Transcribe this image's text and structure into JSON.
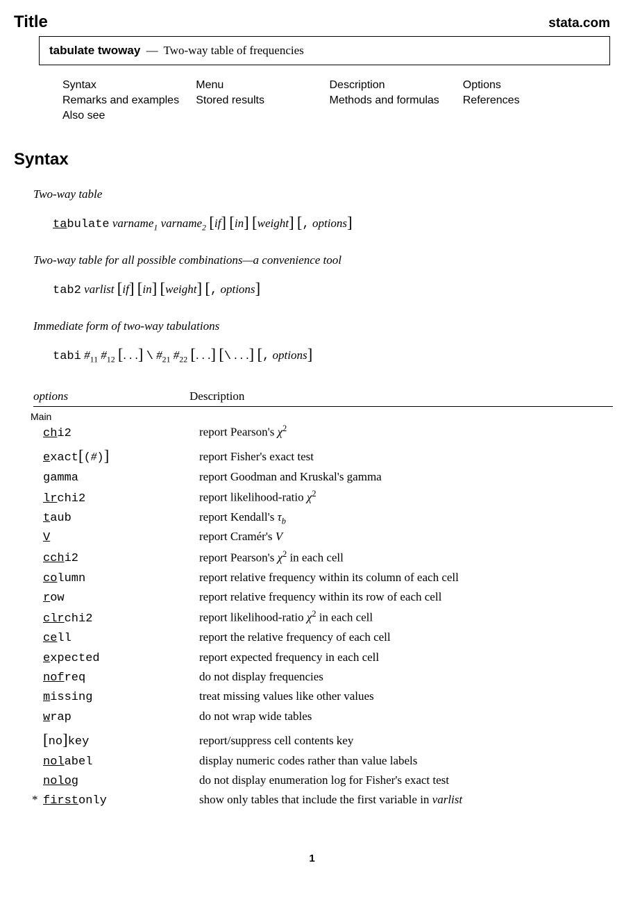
{
  "header": {
    "title": "Title",
    "site": "stata.com"
  },
  "titlebox": {
    "cmd": "tabulate twoway",
    "dash": "—",
    "desc": "Two-way table of frequencies"
  },
  "nav": {
    "r1c1": "Syntax",
    "r1c2": "Menu",
    "r1c3": "Description",
    "r1c4": "Options",
    "r2c1": "Remarks and examples",
    "r2c2": "Stored results",
    "r2c3": "Methods and formulas",
    "r2c4": "References",
    "r3c1": "Also see"
  },
  "section_syntax": "Syntax",
  "sub1": "Two-way table",
  "syn1": {
    "cmd_u": "ta",
    "cmd_r": "bulate",
    "v1": "varname",
    "v2": "varname",
    "if": "if",
    "in": "in",
    "wt": "weight",
    "comma": ",",
    "opts": "options"
  },
  "sub2": "Two-way table for all possible combinations—a convenience tool",
  "syn2": {
    "cmd": "tab2",
    "vl": "varlist",
    "if": "if",
    "in": "in",
    "wt": "weight",
    "comma": ",",
    "opts": "options"
  },
  "sub3": "Immediate form of two-way tabulations",
  "syn3": {
    "cmd": "tabi",
    "hash": "#",
    "dots": ". . .",
    "bs": "\\",
    "comma": ",",
    "opts": "options"
  },
  "opthead": {
    "c1": "options",
    "c2": "Description"
  },
  "group_main": "Main",
  "opts": {
    "chi2": {
      "u": "ch",
      "r": "i2",
      "desc_a": "report Pearson's ",
      "desc_b": ""
    },
    "exact": {
      "u": "e",
      "r": "xact",
      "arg_l": "(",
      "arg_h": "#",
      "arg_r": ")",
      "desc": "report Fisher's exact test"
    },
    "gamma": {
      "u": "g",
      "r": "amma",
      "desc": "report Goodman and Kruskal's gamma"
    },
    "lrchi2": {
      "u": "lr",
      "r": "chi2",
      "desc_a": "report likelihood-ratio "
    },
    "taub": {
      "u": "t",
      "r": "aub",
      "desc_a": "report Kendall's "
    },
    "V": {
      "u": "V",
      "r": "",
      "desc_a": "report Cramér's ",
      "sym": "V"
    },
    "cchi2": {
      "u": "cch",
      "r": "i2",
      "desc_a": "report Pearson's ",
      "desc_b": " in each cell"
    },
    "column": {
      "u": "co",
      "r": "lumn",
      "desc": "report relative frequency within its column of each cell"
    },
    "row": {
      "u": "r",
      "r": "ow",
      "desc": "report relative frequency within its row of each cell"
    },
    "clrchi2": {
      "u": "clr",
      "r": "chi2",
      "desc_a": "report likelihood-ratio ",
      "desc_b": " in each cell"
    },
    "cell": {
      "u": "ce",
      "r": "ll",
      "desc": "report the relative frequency of each cell"
    },
    "expected": {
      "u": "e",
      "r": "xpected",
      "desc": "report expected frequency in each cell"
    },
    "nofreq": {
      "u": "nof",
      "r": "req",
      "desc": "do not display frequencies"
    },
    "missing": {
      "u": "m",
      "r": "issing",
      "desc": "treat missing values like other values"
    },
    "wrap": {
      "u": "w",
      "r": "rap",
      "desc": "do not wrap wide tables"
    },
    "nokey": {
      "pre": "no",
      "r": "key",
      "desc": "report/suppress cell contents key"
    },
    "nolabel": {
      "u": "nol",
      "r": "abel",
      "desc": "display numeric codes rather than value labels"
    },
    "nolog": {
      "u": "nolog",
      "r": "",
      "desc": "do not display enumeration log for Fisher's exact test"
    },
    "firstonly": {
      "star": "*",
      "u": "first",
      "r": "only",
      "desc_a": "show only tables that include the first variable in ",
      "desc_b": "varlist"
    }
  },
  "pagenum": "1"
}
